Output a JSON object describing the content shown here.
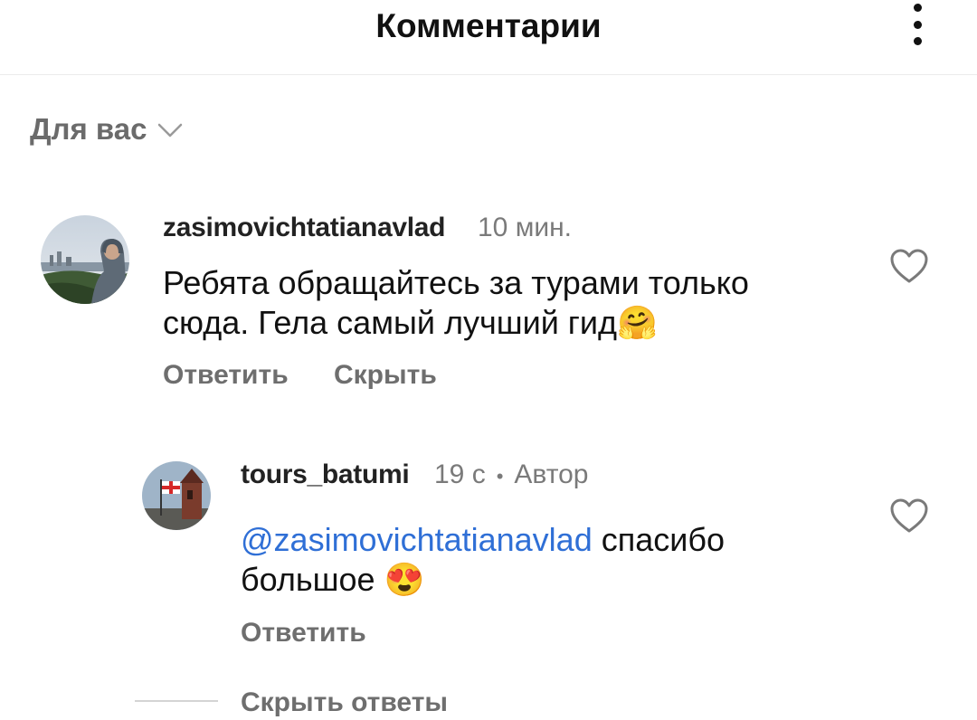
{
  "header": {
    "title": "Комментарии",
    "more_icon": "more-vertical-icon"
  },
  "sort": {
    "label": "Для вас",
    "icon": "chevron-down-icon"
  },
  "comments": [
    {
      "username": "zasimovichtatianavlad",
      "time": "10 мин.",
      "text": "Ребята обращайтесь за турами только сюда. Гела самый лучший гид",
      "emoji": "🤗",
      "actions": {
        "reply": "Ответить",
        "hide": "Скрыть"
      },
      "like_icon": "heart-outline-icon"
    }
  ],
  "reply": {
    "username": "tours_batumi",
    "time": "19 с",
    "separator": "•",
    "author_badge": "Автор",
    "mention": "@zasimovichtatianavlad",
    "text": " спасибо большое",
    "emoji": "😍",
    "actions": {
      "reply": "Ответить"
    },
    "like_icon": "heart-outline-icon"
  },
  "thread": {
    "hide_replies": "Скрыть ответы"
  }
}
